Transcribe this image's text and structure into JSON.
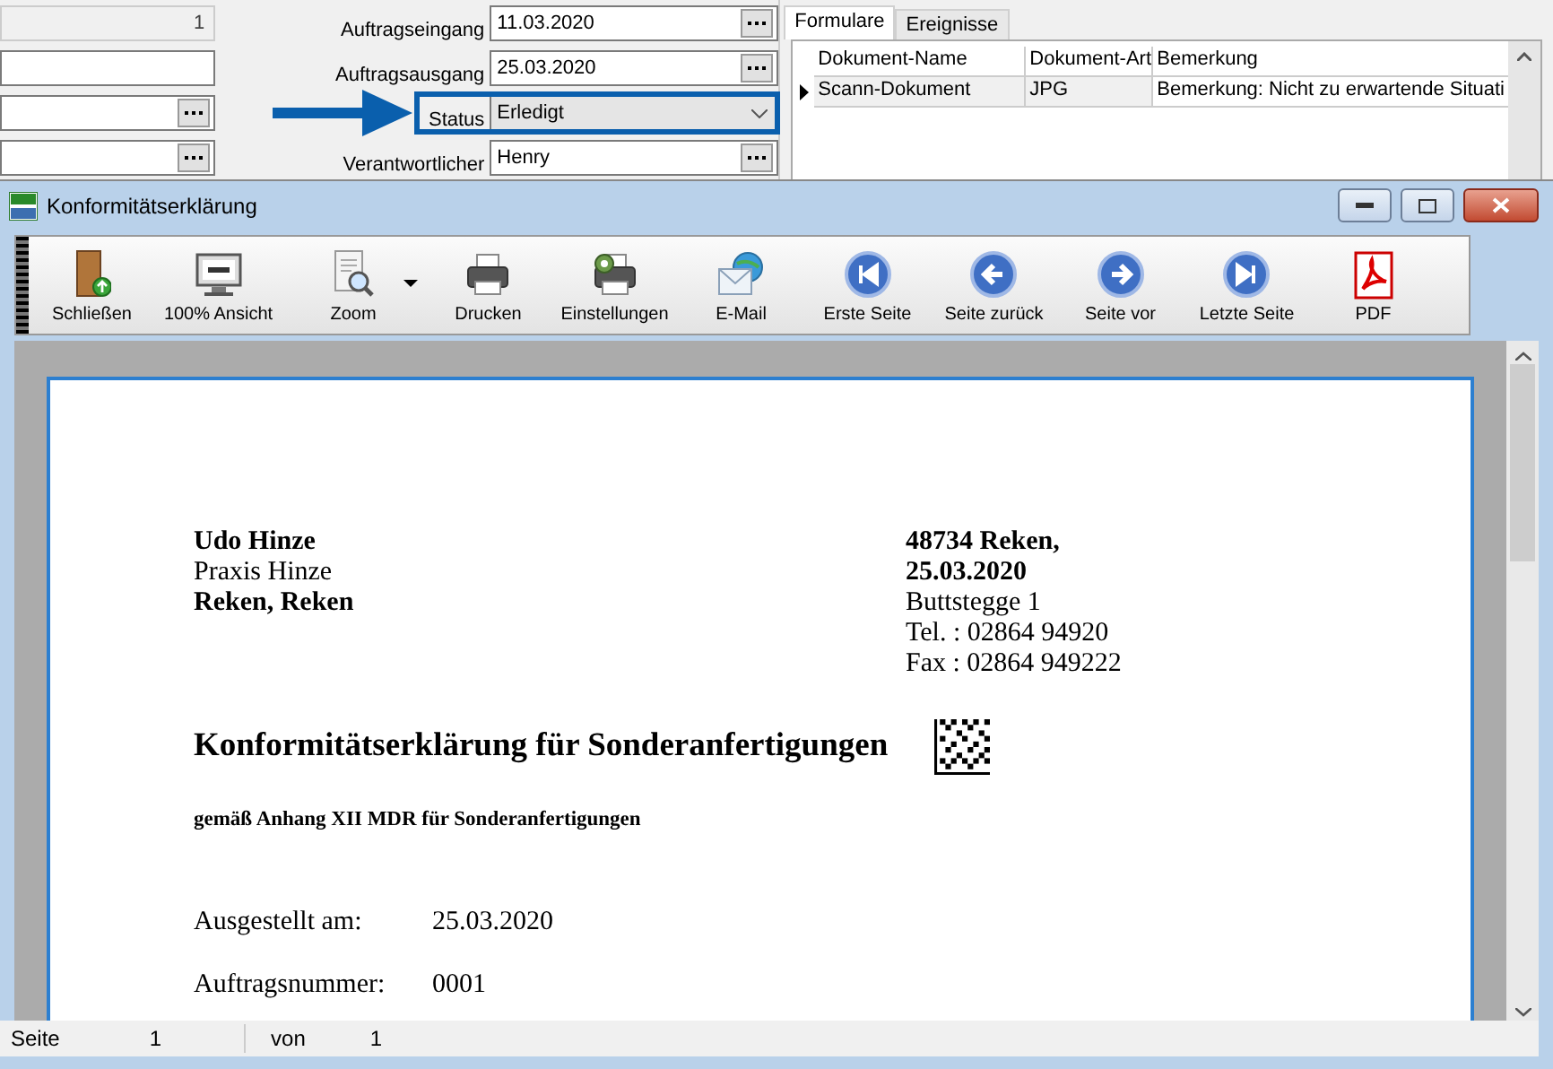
{
  "left_fields": [
    {
      "kind": "text",
      "value": "1",
      "disabled": true
    },
    {
      "kind": "text",
      "disabled": false
    },
    {
      "kind": "lookup",
      "disabled": false
    },
    {
      "kind": "lookup",
      "disabled": false
    }
  ],
  "order_fields": [
    {
      "label": "Auftragseingang",
      "kind": "lookup",
      "value": "11.03.2020",
      "highlighted": false
    },
    {
      "label": "Auftragsausgang",
      "kind": "lookup",
      "value": "25.03.2020",
      "highlighted": false
    },
    {
      "label": "Status",
      "kind": "select",
      "value": "Erledigt",
      "highlighted": true
    },
    {
      "label": "Verantwortlicher",
      "kind": "lookup",
      "value": "Henry",
      "highlighted": false
    }
  ],
  "tabs": [
    {
      "label": "Formulare",
      "selected": true
    },
    {
      "label": "Ereignisse",
      "selected": false
    }
  ],
  "documents": {
    "columns": [
      "Dokument-Name",
      "Dokument-Art",
      "Bemerkung"
    ],
    "rows": [
      {
        "selected": true,
        "cells": [
          "Scann-Dokument",
          "JPG",
          "Bemerkung: Nicht zu erwartende Situati"
        ]
      }
    ]
  },
  "window": {
    "title": "Konformitätserklärung"
  },
  "toolbar": [
    {
      "label": "Schließen",
      "kind": "door",
      "menu": false
    },
    {
      "label": "100% Ansicht",
      "kind": "monitor",
      "menu": false
    },
    {
      "label": "Zoom",
      "kind": "zoom",
      "menu": true
    },
    {
      "label": "Drucken",
      "kind": "printer",
      "menu": false
    },
    {
      "label": "Einstellungen",
      "kind": "printer-settings",
      "menu": false
    },
    {
      "label": "E-Mail",
      "kind": "mail",
      "menu": false
    },
    {
      "label": "Erste Seite",
      "kind": "first",
      "menu": false
    },
    {
      "label": "Seite zurück",
      "kind": "prev",
      "menu": false
    },
    {
      "label": "Seite vor",
      "kind": "next",
      "menu": false
    },
    {
      "label": "Letzte Seite",
      "kind": "last",
      "menu": false
    },
    {
      "label": "PDF",
      "kind": "pdf",
      "menu": false
    }
  ],
  "document": {
    "sender": [
      {
        "text": "Udo Hinze",
        "bold": true
      },
      {
        "text": "Praxis Hinze",
        "bold": false
      },
      {
        "text": "Reken, Reken",
        "bold": true
      }
    ],
    "address": [
      {
        "text": "48734 Reken,",
        "bold": true
      },
      {
        "text": "25.03.2020",
        "bold": true
      },
      {
        "text": "Buttstegge 1",
        "bold": false
      },
      {
        "text": "Tel. : 02864 94920",
        "bold": false
      },
      {
        "text": "Fax : 02864 949222",
        "bold": false
      }
    ],
    "title": "Konformitätserklärung für Sonderanfertigungen",
    "subtitle": "gemäß Anhang XII MDR für Sonderanfertigungen",
    "fields": [
      {
        "label": "Ausgestellt am:",
        "value": "25.03.2020"
      },
      {
        "label": "Auftragsnummer:",
        "value": "0001"
      }
    ]
  },
  "status_bar": {
    "page_label": "Seite",
    "page": "1",
    "of_label": "von",
    "total": "1"
  }
}
